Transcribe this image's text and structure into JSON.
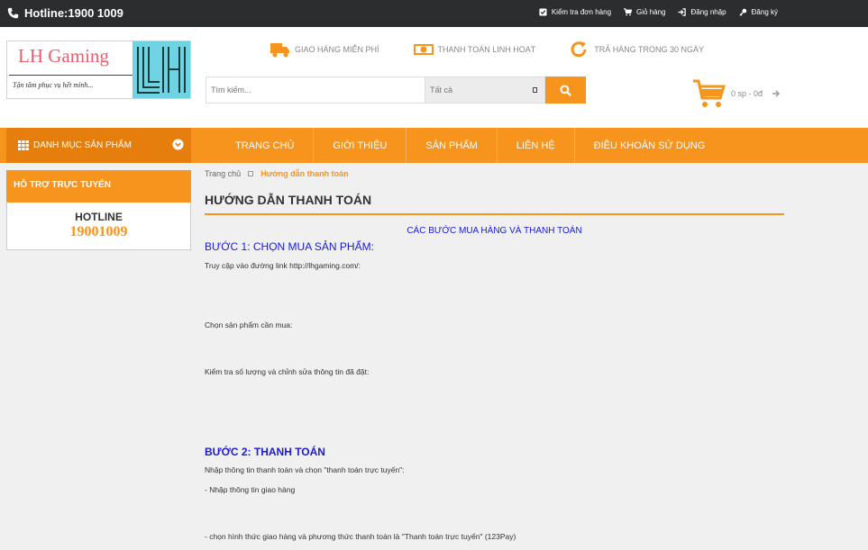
{
  "topbar": {
    "hotline": "Hotline:1900 1009",
    "links": [
      {
        "label": "Kiểm tra đơn hàng",
        "icon": "check-square-icon"
      },
      {
        "label": "Giỏ hàng",
        "icon": "cart-icon"
      },
      {
        "label": "Đăng nhập",
        "icon": "sign-in-icon"
      },
      {
        "label": "Đăng ký",
        "icon": "key-icon"
      }
    ]
  },
  "logo": {
    "title": "LH Gaming",
    "tagline": "Tận tâm phục vụ hết mình..."
  },
  "perks": [
    {
      "label": "GIAO HÀNG MIỄN PHÍ",
      "icon": "truck-icon"
    },
    {
      "label": "THANH TOÁN LINH HOẠT",
      "icon": "money-icon"
    },
    {
      "label": "TRẢ HÀNG TRONG 30 NGÀY",
      "icon": "refresh-icon"
    }
  ],
  "search": {
    "placeholder": "Tìm kiếm...",
    "category": "Tất cả"
  },
  "cart": {
    "summary": "0 sp - 0đ"
  },
  "nav": {
    "category_menu": "DANH MỤC SẢN PHẨM",
    "items": [
      "TRANG CHỦ",
      "GIỚI THIỆU",
      "SẢN PHẨM",
      "LIÊN HỆ",
      "ĐIỀU KHOẢN SỬ DỤNG"
    ]
  },
  "sidebar": {
    "support_title": "HỖ TRỢ TRỰC TUYẾN",
    "hotline_label": "HOTLINE",
    "hotline_number": "19001009"
  },
  "breadcrumb": {
    "home": "Trang chủ",
    "current": "Hướng dẫn thanh toán"
  },
  "content": {
    "title": "HƯỚNG DẪN THANH TOÁN",
    "subtitle": "CÁC BƯỚC MUA HÀNG VÀ THANH TOÁN",
    "step1": "BƯỚC 1:  CHỌN MUA SẢN PHẨM:",
    "step1_line1": "Truy cập vào đường link http://lhgaming.com/:",
    "step1_line2": "Chọn sản phẩm cần mua:",
    "step1_line3": " Kiểm tra số lượng và chỉnh sửa thông tin đã đặt:",
    "step2": "BƯỚC 2: THANH TOÁN",
    "step2_line1": "Nhập thông tin thanh toán và chọn \"thanh toán trực tuyến\":",
    "step2_line2": "- Nhập thông tin giao hàng",
    "step2_line3": "- chọn hình thức giao hàng và phương thức thanh toán là \"Thanh toán trực tuyến\" (123Pay)"
  },
  "colors": {
    "accent": "#f7941d",
    "topbar": "#2b2d2f",
    "link_blue": "#1a1ad8"
  }
}
